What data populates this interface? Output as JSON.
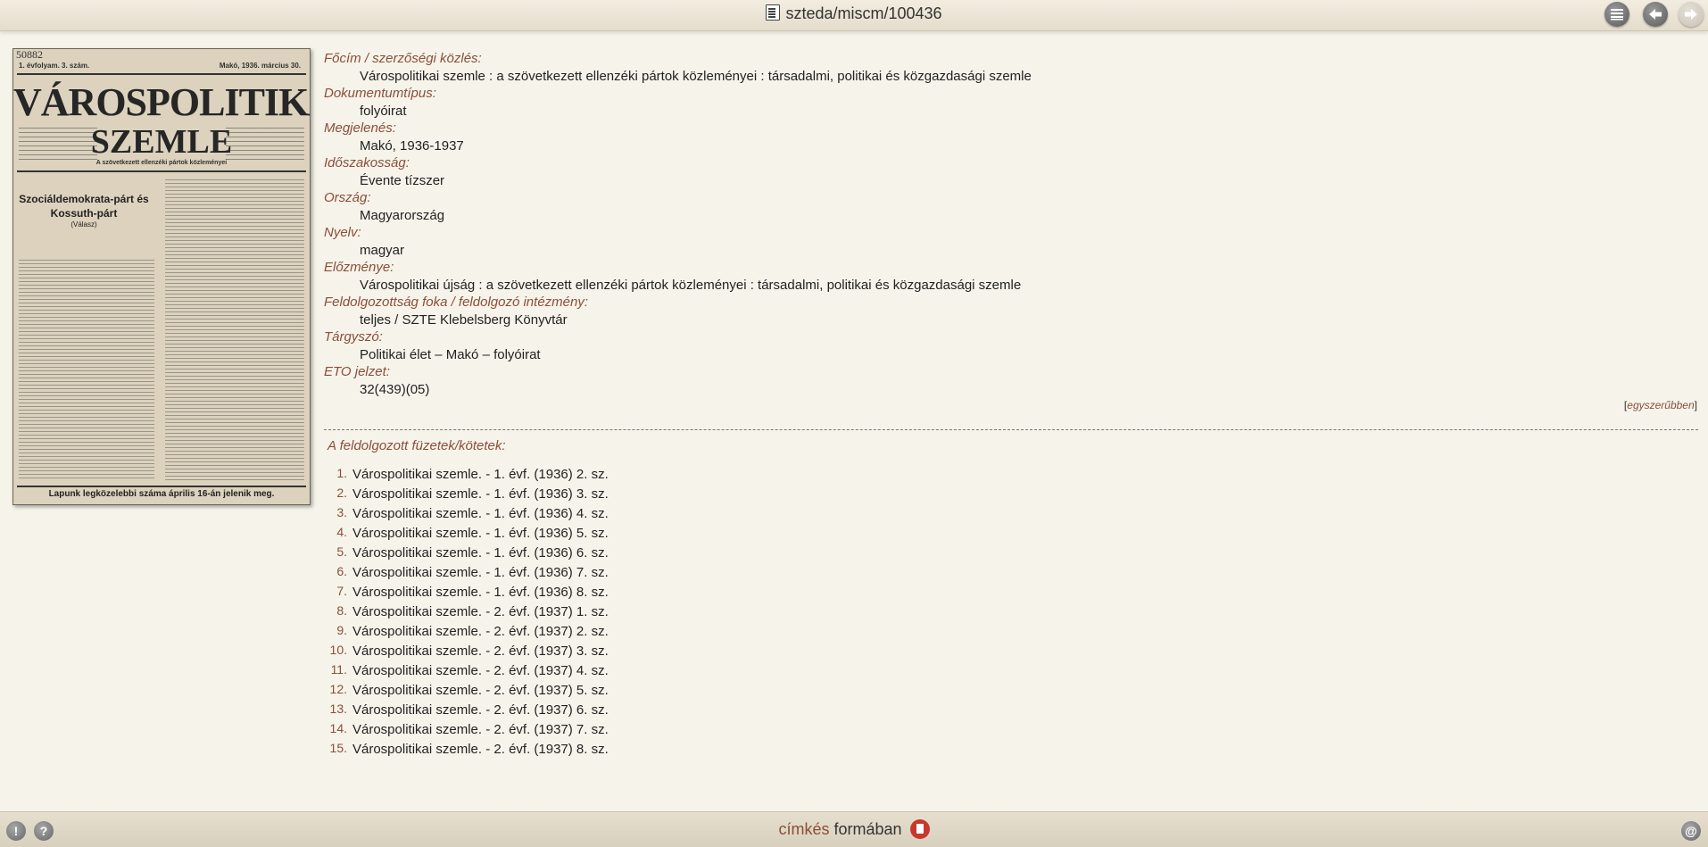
{
  "topbar": {
    "title": "szteda/miscm/100436",
    "list_icon": "list-icon",
    "back_icon": "arrow-left-icon",
    "forward_icon": "arrow-right-icon"
  },
  "cover": {
    "number": "50882",
    "issue_line": "1. évfolyam. 3. szám.",
    "date_line": "Makó, 1936. március 30.",
    "title_line1": "VÁROSPOLITIKAI",
    "title_line2": "SZEMLE",
    "subtitle": "A szövetkezett ellenzéki pártok közleményei",
    "headline": "Szociáldemokrata-párt és Kossuth-párt",
    "headline_sub": "(Válasz)",
    "bottom_line": "Lapunk legközelebbi száma április 16-án jelenik meg."
  },
  "fields": [
    {
      "label": "Főcím / szerzőségi közlés:",
      "value": "Várospolitikai szemle : a szövetkezett ellenzéki pártok közleményei : társadalmi, politikai és közgazdasági szemle"
    },
    {
      "label": "Dokumentumtípus:",
      "value": "folyóirat"
    },
    {
      "label": "Megjelenés:",
      "value": "Makó, 1936-1937"
    },
    {
      "label": "Időszakosság:",
      "value": "Évente tízszer"
    },
    {
      "label": "Ország:",
      "value": "Magyarország"
    },
    {
      "label": "Nyelv:",
      "value": "magyar"
    },
    {
      "label": "Előzménye:",
      "value": "Várospolitikai újság : a szövetkezett ellenzéki pártok közleményei : társadalmi, politikai és közgazdasági szemle"
    },
    {
      "label": "Feldolgozottság foka / feldolgozó intézmény:",
      "value": "teljes / SZTE Klebelsberg Könyvtár"
    },
    {
      "label": "Tárgyszó:",
      "value": "Politikai élet – Makó – folyóirat"
    },
    {
      "label": "ETO jelzet:",
      "value": "32(439)(05)"
    }
  ],
  "simple_view": {
    "open": "[",
    "link": "egyszerűbben",
    "close": "]"
  },
  "volumes_heading": "A feldolgozott füzetek/kötetek:",
  "volumes": [
    {
      "num": "1.",
      "text": "Várospolitikai szemle. - 1. évf. (1936) 2. sz."
    },
    {
      "num": "2.",
      "text": "Várospolitikai szemle. - 1. évf. (1936) 3. sz."
    },
    {
      "num": "3.",
      "text": "Várospolitikai szemle. - 1. évf. (1936) 4. sz."
    },
    {
      "num": "4.",
      "text": "Várospolitikai szemle. - 1. évf. (1936) 5. sz."
    },
    {
      "num": "5.",
      "text": "Várospolitikai szemle. - 1. évf. (1936) 6. sz."
    },
    {
      "num": "6.",
      "text": "Várospolitikai szemle. - 1. évf. (1936) 7. sz."
    },
    {
      "num": "7.",
      "text": "Várospolitikai szemle. - 1. évf. (1936) 8. sz."
    },
    {
      "num": "8.",
      "text": "Várospolitikai szemle. - 2. évf. (1937) 1. sz."
    },
    {
      "num": "9.",
      "text": "Várospolitikai szemle. - 2. évf. (1937) 2. sz."
    },
    {
      "num": "10.",
      "text": "Várospolitikai szemle. - 2. évf. (1937) 3. sz."
    },
    {
      "num": "11.",
      "text": "Várospolitikai szemle. - 2. évf. (1937) 4. sz."
    },
    {
      "num": "12.",
      "text": "Várospolitikai szemle. - 2. évf. (1937) 5. sz."
    },
    {
      "num": "13.",
      "text": "Várospolitikai szemle. - 2. évf. (1937) 6. sz."
    },
    {
      "num": "14.",
      "text": "Várospolitikai szemle. - 2. évf. (1937) 7. sz."
    },
    {
      "num": "15.",
      "text": "Várospolitikai szemle. - 2. évf. (1937) 8. sz."
    }
  ],
  "bottombar": {
    "format_word1": "címkés",
    "format_word2": "formában",
    "alert_glyph": "!",
    "help_glyph": "?",
    "at_glyph": "@",
    "alert_icon": "alert-icon",
    "help_icon": "help-icon",
    "at_icon": "at-sign-icon",
    "format_icon": "document-icon"
  }
}
